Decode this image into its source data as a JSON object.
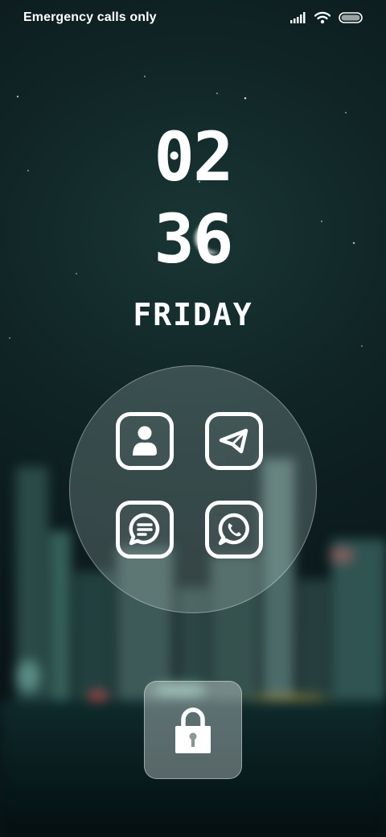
{
  "status_bar": {
    "carrier_text": "Emergency calls only",
    "icons": [
      "signal-icon",
      "wifi-icon",
      "battery-icon"
    ]
  },
  "clock": {
    "hours": "02",
    "minutes": "36",
    "day": "FRIDAY"
  },
  "shortcuts": [
    {
      "name": "contacts",
      "icon": "contacts-icon"
    },
    {
      "name": "telegram",
      "icon": "telegram-icon"
    },
    {
      "name": "messages",
      "icon": "messages-icon"
    },
    {
      "name": "whatsapp",
      "icon": "whatsapp-icon"
    }
  ],
  "lock": {
    "icon": "lock-icon"
  },
  "colors": {
    "foreground": "#ffffff",
    "wallpaper_tint": "#12302f"
  }
}
